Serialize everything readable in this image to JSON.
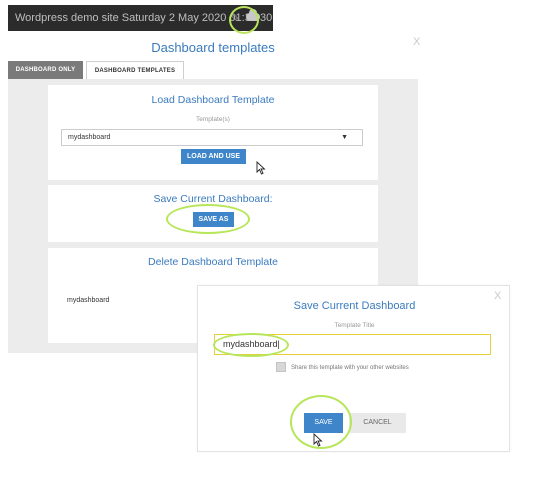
{
  "topbar": {
    "text": "Wordpress demo site Saturday 2 May 2020 01:37:30",
    "pencil_icon": "pencil-icon",
    "cloud_icon": "cloud-icon"
  },
  "dialog": {
    "title": "Dashboard templates",
    "close": "X"
  },
  "tabs": [
    {
      "label": "DASHBOARD ONLY",
      "active": false
    },
    {
      "label": "DASHBOARD TEMPLATES",
      "active": true
    }
  ],
  "load": {
    "title": "Load Dashboard Template",
    "label": "Template(s)",
    "selected": "mydashboard",
    "button": "LOAD AND USE"
  },
  "save": {
    "title": "Save Current Dashboard:",
    "button": "SAVE AS"
  },
  "delete": {
    "title": "Delete Dashboard Template",
    "value": "mydashboard"
  },
  "modal": {
    "title": "Save Current Dashboard",
    "close": "X",
    "field_label": "Template Title",
    "field_value": "mydashboard",
    "share_label": "Share this template with your other websites",
    "save_button": "SAVE",
    "cancel_button": "CANCEL"
  },
  "colors": {
    "accent": "#3e86c9",
    "highlight": "#b7e65a",
    "title_blue": "#3a7bbf"
  }
}
